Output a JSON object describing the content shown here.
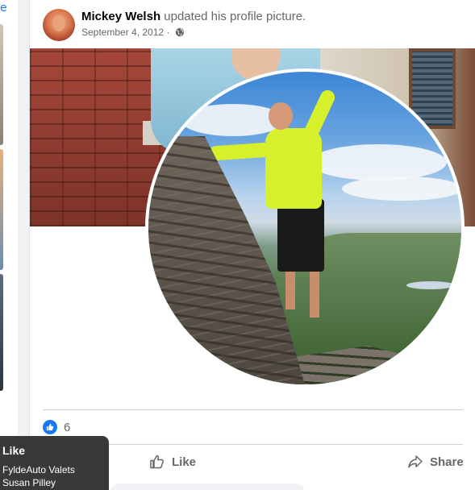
{
  "left_column": {
    "link_text": "e"
  },
  "post": {
    "author": "Mickey Welsh",
    "action_text": "updated his profile picture.",
    "date": "September 4, 2012 ·",
    "privacy_icon": "globe-icon"
  },
  "reactions": {
    "icon": "like-icon",
    "count": "6"
  },
  "actions": {
    "like_label": "Like",
    "share_label": "Share"
  },
  "tooltip": {
    "title": "Like",
    "names": [
      "FyldeAuto Valets",
      "Susan Pilley"
    ]
  },
  "colors": {
    "accent": "#1877f2",
    "secondary_text": "#65676b",
    "divider": "#ced0d4"
  }
}
